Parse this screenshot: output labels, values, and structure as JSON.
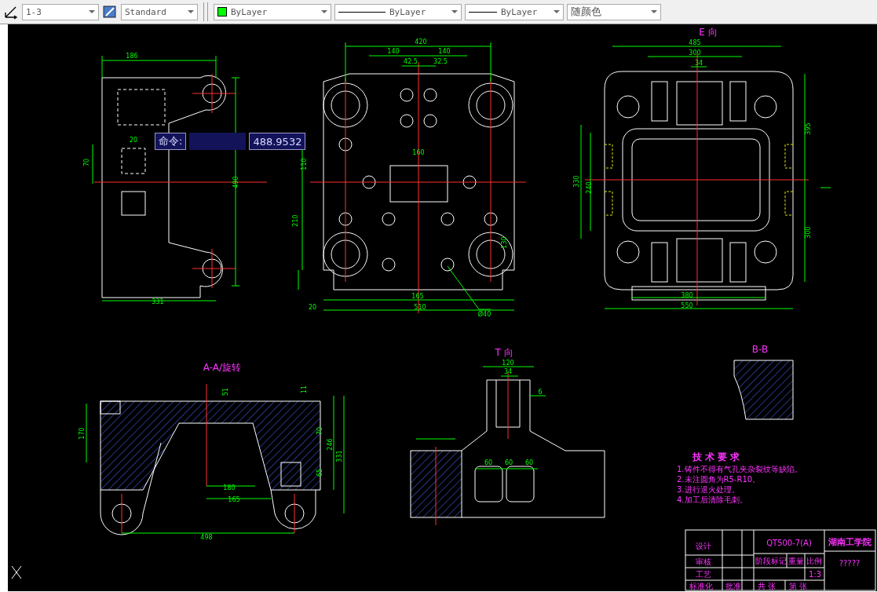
{
  "toolbar": {
    "dimension_style": "1-3",
    "text_style": "Standard",
    "color_label": "ByLayer",
    "color": "#00ff00",
    "linetype": "ByLayer",
    "lineweight": "ByLayer",
    "plot_style": "随颜色"
  },
  "command_tooltip": {
    "label": "命令:",
    "value": "488.9532"
  },
  "views": [
    {
      "kind": "side",
      "dims": [
        "186",
        "20",
        "70",
        "490",
        "331"
      ]
    },
    {
      "kind": "front",
      "dims": [
        "420",
        "140",
        "140",
        "42.5",
        "32.5",
        "160",
        "110",
        "210",
        "130",
        "165",
        "510",
        "20",
        "Ø40"
      ]
    },
    {
      "kind": "e_view",
      "title": "E 向",
      "dims": [
        "485",
        "300",
        "34",
        "395",
        "330",
        "240",
        "300",
        "380",
        "550"
      ]
    },
    {
      "kind": "section_aa",
      "title": "A-A/旋转",
      "dims": [
        "51",
        "11",
        "170",
        "70",
        "246",
        "331",
        "65",
        "180",
        "165",
        "498"
      ]
    },
    {
      "kind": "t_view",
      "title": "T 向",
      "dims": [
        "120",
        "34",
        "6",
        "60",
        "60",
        "60"
      ]
    },
    {
      "kind": "section_bb",
      "title": "B-B"
    }
  ],
  "technical_requirements": {
    "title": "技 术 要 求",
    "items": [
      "1.铸件不得有气孔夹杂裂纹等缺陷。",
      "2.未注圆角为R5-R10。",
      "3.进行退火处理。",
      "4.加工后清除毛刺。"
    ]
  },
  "title_block": {
    "part_code": "QT500-7(A)",
    "school": "湖南工学院",
    "drawing_name": "?????",
    "scale": "1:3",
    "labels": [
      "设计",
      "审核",
      "工艺",
      "标准化",
      "批准",
      "阶段标记",
      "重量",
      "比例",
      "共 张",
      "第 张"
    ]
  }
}
